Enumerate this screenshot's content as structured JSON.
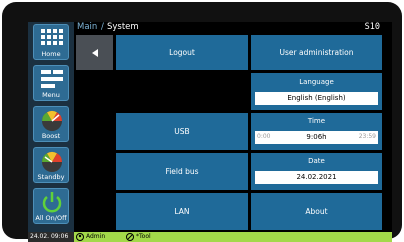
{
  "breadcrumb": {
    "root": "Main",
    "separator": "/",
    "page": "System"
  },
  "device_id": "S10",
  "sidebar": [
    {
      "label": "Home",
      "icon": "grid-icon"
    },
    {
      "label": "Menu",
      "icon": "menu-list-icon"
    },
    {
      "label": "Boost",
      "icon": "boost-gauge-icon"
    },
    {
      "label": "Standby",
      "icon": "standby-gauge-icon"
    },
    {
      "label": "All On/Off",
      "icon": "power-icon"
    }
  ],
  "buttons": {
    "logout": "Logout",
    "user_admin": "User administration",
    "usb": "USB",
    "field_bus": "Field bus",
    "lan": "LAN",
    "about": "About"
  },
  "language": {
    "title": "Language",
    "value": "English (English)"
  },
  "time": {
    "title": "Time",
    "value": "9:06h",
    "min": "0:00",
    "max": "23:59"
  },
  "date": {
    "title": "Date",
    "value": "24.02.2021"
  },
  "status": {
    "datetime": "24.02. 09:06",
    "user": "Admin",
    "tool": "*Tool"
  },
  "colors": {
    "accent": "#1f6a99",
    "status_bar": "#a3d94a"
  }
}
